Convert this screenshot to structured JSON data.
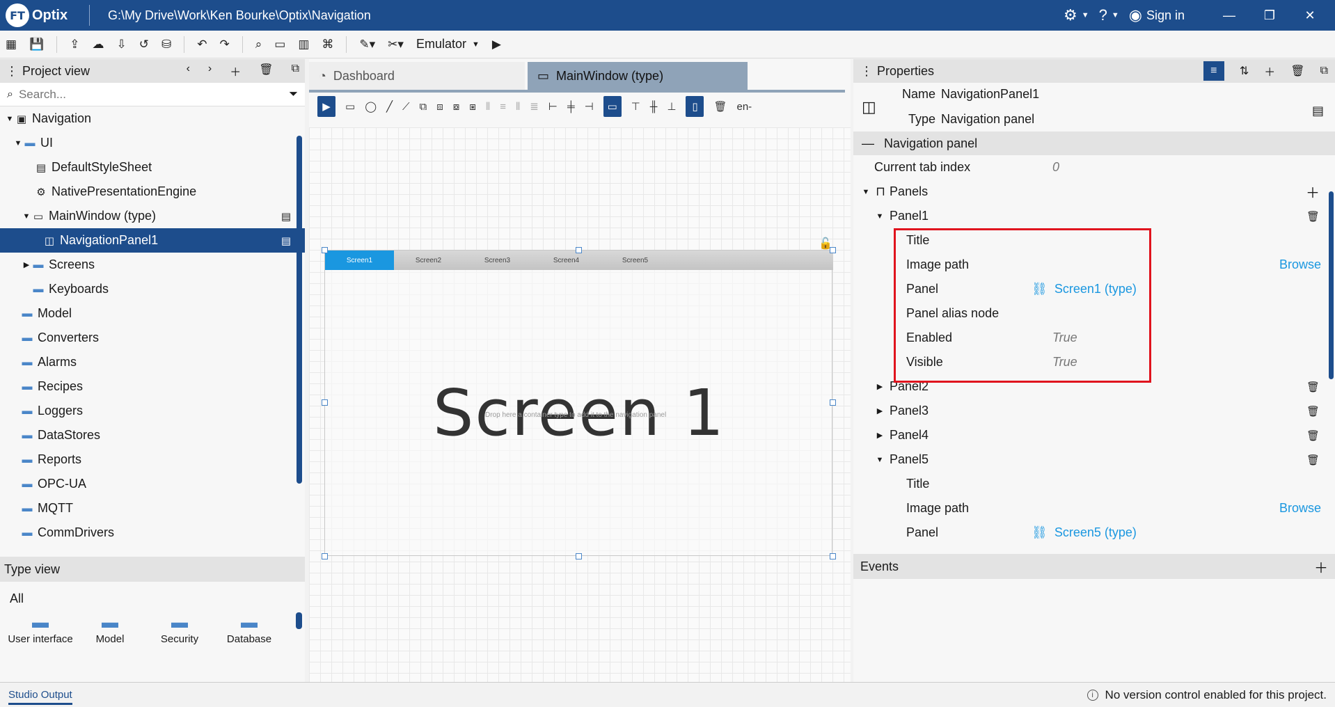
{
  "titlebar": {
    "logo_mark": "FT",
    "logo_text": "Optix",
    "path": "G:\\My Drive\\Work\\Ken Bourke\\Optix\\Navigation",
    "sign_in": "Sign in"
  },
  "toolbar": {
    "emulator_label": "Emulator"
  },
  "project_view": {
    "title": "Project view",
    "search_placeholder": "Search...",
    "tree": [
      {
        "label": "Navigation"
      },
      {
        "label": "UI"
      },
      {
        "label": "DefaultStyleSheet"
      },
      {
        "label": "NativePresentationEngine"
      },
      {
        "label": "MainWindow (type)"
      },
      {
        "label": "NavigationPanel1"
      },
      {
        "label": "Screens"
      },
      {
        "label": "Keyboards"
      },
      {
        "label": "Model"
      },
      {
        "label": "Converters"
      },
      {
        "label": "Alarms"
      },
      {
        "label": "Recipes"
      },
      {
        "label": "Loggers"
      },
      {
        "label": "DataStores"
      },
      {
        "label": "Reports"
      },
      {
        "label": "OPC-UA"
      },
      {
        "label": "MQTT"
      },
      {
        "label": "CommDrivers"
      }
    ]
  },
  "type_view": {
    "title": "Type view",
    "filter": "All",
    "tiles": [
      {
        "label": "User interface"
      },
      {
        "label": "Model"
      },
      {
        "label": "Security"
      },
      {
        "label": "Database"
      }
    ]
  },
  "editor": {
    "tabs": [
      {
        "label": "Dashboard"
      },
      {
        "label": "MainWindow (type)"
      }
    ],
    "locale": "en-",
    "nav_tabs": [
      "Screen1",
      "Screen2",
      "Screen3",
      "Screen4",
      "Screen5"
    ],
    "screen_label": "Screen 1",
    "drop_hint": "Drop here a container type to add it to the navigation panel"
  },
  "properties": {
    "title": "Properties",
    "name_key": "Name",
    "name_value": "NavigationPanel1",
    "type_key": "Type",
    "type_value": "Navigation panel",
    "section": "Navigation panel",
    "current_tab_index_label": "Current tab index",
    "current_tab_index_value": "0",
    "panels_label": "Panels",
    "panel1": {
      "label": "Panel1",
      "title": "Title",
      "image_path": "Image path",
      "browse": "Browse",
      "panel": "Panel",
      "panel_value": "Screen1 (type)",
      "alias": "Panel alias node",
      "enabled": "Enabled",
      "enabled_value": "True",
      "visible": "Visible",
      "visible_value": "True"
    },
    "panel2": "Panel2",
    "panel3": "Panel3",
    "panel4": "Panel4",
    "panel5": {
      "label": "Panel5",
      "title": "Title",
      "image_path": "Image path",
      "browse": "Browse",
      "panel": "Panel",
      "panel_value": "Screen5 (type)"
    },
    "events": "Events"
  },
  "status": {
    "studio_output": "Studio Output",
    "version_control": "No version control enabled for this project."
  },
  "colors": {
    "brand": "#1d4d8c",
    "accent": "#1a97e0",
    "highlight": "#e0141e"
  }
}
